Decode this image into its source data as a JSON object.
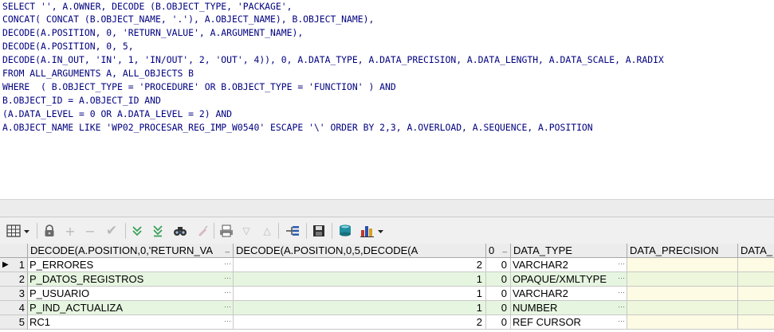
{
  "editor": {
    "lines": [
      "SELECT '', A.OWNER, DECODE (B.OBJECT_TYPE, 'PACKAGE',",
      "CONCAT( CONCAT (B.OBJECT_NAME, '.'), A.OBJECT_NAME), B.OBJECT_NAME),",
      "DECODE(A.POSITION, 0, 'RETURN_VALUE', A.ARGUMENT_NAME),",
      "DECODE(A.POSITION, 0, 5,",
      "DECODE(A.IN_OUT, 'IN', 1, 'IN/OUT', 2, 'OUT', 4)), 0, A.DATA_TYPE, A.DATA_PRECISION, A.DATA_LENGTH, A.DATA_SCALE, A.RADIX",
      "FROM ALL_ARGUMENTS A, ALL_OBJECTS B",
      "WHERE  ( B.OBJECT_TYPE = 'PROCEDURE' OR B.OBJECT_TYPE = 'FUNCTION' ) AND",
      "B.OBJECT_ID = A.OBJECT_ID AND",
      "(A.DATA_LEVEL = 0 OR A.DATA_LEVEL = 2) AND",
      "A.OBJECT_NAME LIKE 'WP02_PROCESAR_REG_IMP_W0540' ESCAPE '\\' ORDER BY 2,3, A.OVERLOAD, A.SEQUENCE, A.POSITION"
    ]
  },
  "toolbar": {
    "icons": [
      "grid-layout-icon",
      "lock-icon",
      "add-record-icon",
      "delete-record-icon",
      "post-edit-icon",
      "fetch-next-page-icon",
      "fetch-last-page-icon",
      "find-icon",
      "clear-records-icon",
      "print-icon",
      "filter-icon",
      "sort-icon",
      "query-plan-icon",
      "save-icon",
      "export-icon",
      "chart-icon"
    ]
  },
  "grid": {
    "columns": [
      "DECODE(A.POSITION,0,'RETURN_VA",
      "DECODE(A.POSITION,0,5,DECODE(A",
      "0",
      "DATA_TYPE",
      "DATA_PRECISION",
      "DATA_"
    ],
    "rows": [
      {
        "index": "1",
        "arg": "P_ERRORES",
        "pos": "2",
        "zero": "0",
        "type": "VARCHAR2"
      },
      {
        "index": "2",
        "arg": "P_DATOS_REGISTROS",
        "pos": "1",
        "zero": "0",
        "type": "OPAQUE/XMLTYPE"
      },
      {
        "index": "3",
        "arg": "P_USUARIO",
        "pos": "1",
        "zero": "0",
        "type": "VARCHAR2"
      },
      {
        "index": "4",
        "arg": "P_IND_ACTUALIZA",
        "pos": "1",
        "zero": "0",
        "type": "NUMBER"
      },
      {
        "index": "5",
        "arg": "RC1",
        "pos": "2",
        "zero": "0",
        "type": "REF CURSOR"
      }
    ],
    "colors": {
      "row_alt_bg": "#e6f5e0",
      "null_cell_bg": "#fdfbe3",
      "null_cell_alt_bg": "#eef7dc"
    }
  },
  "colors": {
    "keyword": "#008080",
    "text": "#000080",
    "string": "#000080"
  }
}
